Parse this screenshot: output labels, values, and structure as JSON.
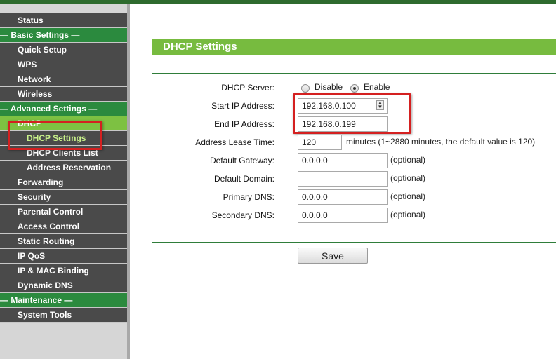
{
  "sidebar": {
    "items": [
      {
        "label": "Status",
        "kind": "item"
      },
      {
        "label": "— Basic Settings —",
        "kind": "section"
      },
      {
        "label": "Quick Setup",
        "kind": "item"
      },
      {
        "label": "WPS",
        "kind": "item"
      },
      {
        "label": "Network",
        "kind": "item"
      },
      {
        "label": "Wireless",
        "kind": "item"
      },
      {
        "label": "— Advanced Settings —",
        "kind": "section"
      },
      {
        "label": "DHCP",
        "kind": "active"
      },
      {
        "label": "DHCP Settings",
        "kind": "active-sub"
      },
      {
        "label": "DHCP Clients List",
        "kind": "sub"
      },
      {
        "label": "Address Reservation",
        "kind": "sub"
      },
      {
        "label": "Forwarding",
        "kind": "item"
      },
      {
        "label": "Security",
        "kind": "item"
      },
      {
        "label": "Parental Control",
        "kind": "item"
      },
      {
        "label": "Access Control",
        "kind": "item"
      },
      {
        "label": "Static Routing",
        "kind": "item"
      },
      {
        "label": "IP QoS",
        "kind": "item"
      },
      {
        "label": "IP & MAC Binding",
        "kind": "item"
      },
      {
        "label": "Dynamic DNS",
        "kind": "item"
      },
      {
        "label": "— Maintenance —",
        "kind": "section"
      },
      {
        "label": "System Tools",
        "kind": "item"
      }
    ]
  },
  "page": {
    "title": "DHCP Settings",
    "dhcp_server": {
      "label": "DHCP Server:",
      "options": [
        "Disable",
        "Enable"
      ],
      "selected": "Enable"
    },
    "start_ip": {
      "label": "Start IP Address:",
      "value": "192.168.0.100"
    },
    "end_ip": {
      "label": "End IP Address:",
      "value": "192.168.0.199"
    },
    "lease_time": {
      "label": "Address Lease Time:",
      "value": "120",
      "hint": "minutes (1~2880 minutes, the default value is 120)"
    },
    "gateway": {
      "label": "Default Gateway:",
      "value": "0.0.0.0",
      "hint": "(optional)"
    },
    "domain": {
      "label": "Default Domain:",
      "value": "",
      "hint": "(optional)"
    },
    "primary_dns": {
      "label": "Primary DNS:",
      "value": "0.0.0.0",
      "hint": "(optional)"
    },
    "secondary_dns": {
      "label": "Secondary DNS:",
      "value": "0.0.0.0",
      "hint": "(optional)"
    },
    "save_label": "Save"
  },
  "colors": {
    "title_bar": "#77bb3f",
    "section_green": "#2b8a3e",
    "nav_dark": "#4a4a4a",
    "active_green": "#7dc142",
    "highlight_red": "#d42020"
  }
}
